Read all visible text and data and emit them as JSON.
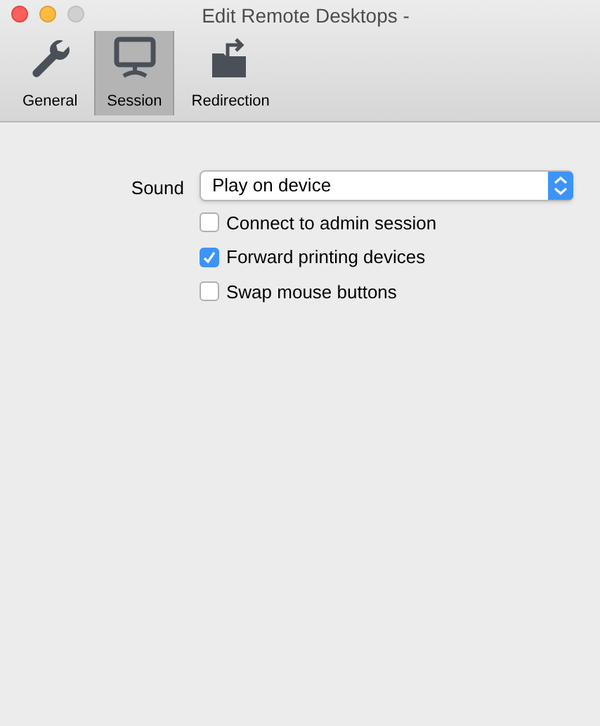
{
  "window": {
    "title": "Edit Remote Desktops -"
  },
  "tabs": [
    {
      "label": "General",
      "kind": "wrench",
      "selected": false
    },
    {
      "label": "Session",
      "kind": "monitor",
      "selected": true
    },
    {
      "label": "Redirection",
      "kind": "folder",
      "selected": false
    }
  ],
  "sound": {
    "label": "Sound",
    "value": "Play on device"
  },
  "options": [
    {
      "label": "Connect to admin session",
      "checked": false
    },
    {
      "label": "Forward printing devices",
      "checked": true
    },
    {
      "label": "Swap mouse buttons",
      "checked": false
    }
  ]
}
